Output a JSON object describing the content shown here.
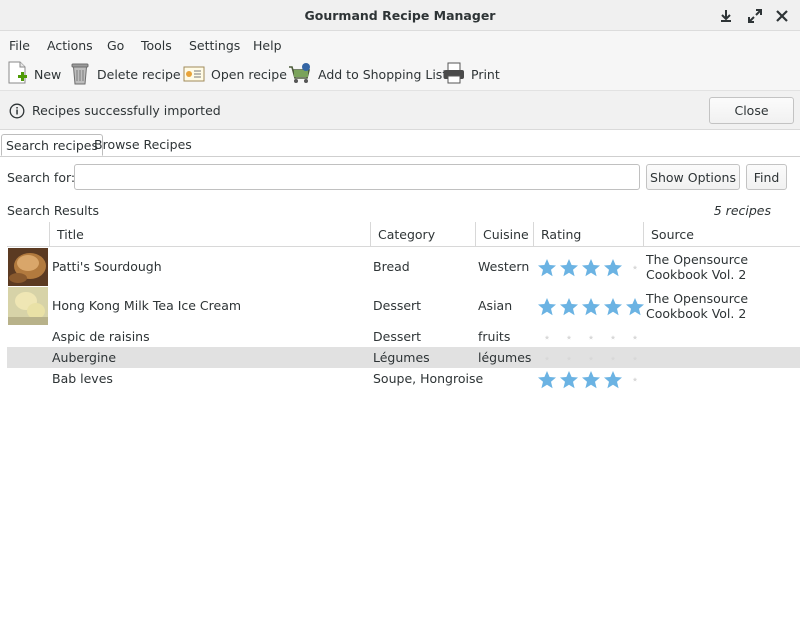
{
  "window": {
    "title": "Gourmand Recipe Manager"
  },
  "menu": [
    "File",
    "Actions",
    "Go",
    "Tools",
    "Settings",
    "Help"
  ],
  "toolbar": {
    "new_label": "New",
    "delete_label": "Delete recipe",
    "open_label": "Open recipe",
    "shopping_label": "Add to Shopping List",
    "print_label": "Print"
  },
  "infobar": {
    "message": "Recipes successfully imported",
    "close_label": "Close"
  },
  "tabs": [
    "Search recipes",
    "Browse Recipes"
  ],
  "search": {
    "label": "Search for:",
    "value": "",
    "placeholder": "",
    "show_options_label": "Show Options",
    "find_label": "Find"
  },
  "results": {
    "label": "Search Results",
    "count": "5 recipes",
    "columns": [
      "Title",
      "Category",
      "Cuisine",
      "Rating",
      "Source"
    ],
    "rows": [
      {
        "title": "Patti's Sourdough",
        "category": "Bread",
        "cuisine": "Western",
        "rating": 4,
        "source_line1": "The Opensource",
        "source_line2": "Cookbook Vol. 2",
        "thumbnail": "bread-thumbnail"
      },
      {
        "title": "Hong Kong Milk Tea Ice Cream",
        "category": "Dessert",
        "cuisine": "Asian",
        "rating": 5,
        "source_line1": "The Opensource",
        "source_line2": "Cookbook Vol. 2",
        "thumbnail": "ice-cream-thumbnail"
      },
      {
        "title": "Aspic de raisins",
        "category": "Dessert",
        "cuisine": "fruits",
        "rating": 0,
        "source_line1": "",
        "source_line2": ""
      },
      {
        "title": "Aubergine",
        "category": "Légumes",
        "cuisine": "légumes",
        "rating": 0,
        "source_line1": "",
        "source_line2": "",
        "selected": true
      },
      {
        "title": "Bab leves",
        "category": "Soupe, Hongroise",
        "cuisine": "",
        "rating": 4,
        "source_line1": "",
        "source_line2": ""
      }
    ]
  },
  "colors": {
    "star_filled": "#6bb3e3",
    "star_empty": "#d8d8d8",
    "selection": "#e1e1e1"
  }
}
